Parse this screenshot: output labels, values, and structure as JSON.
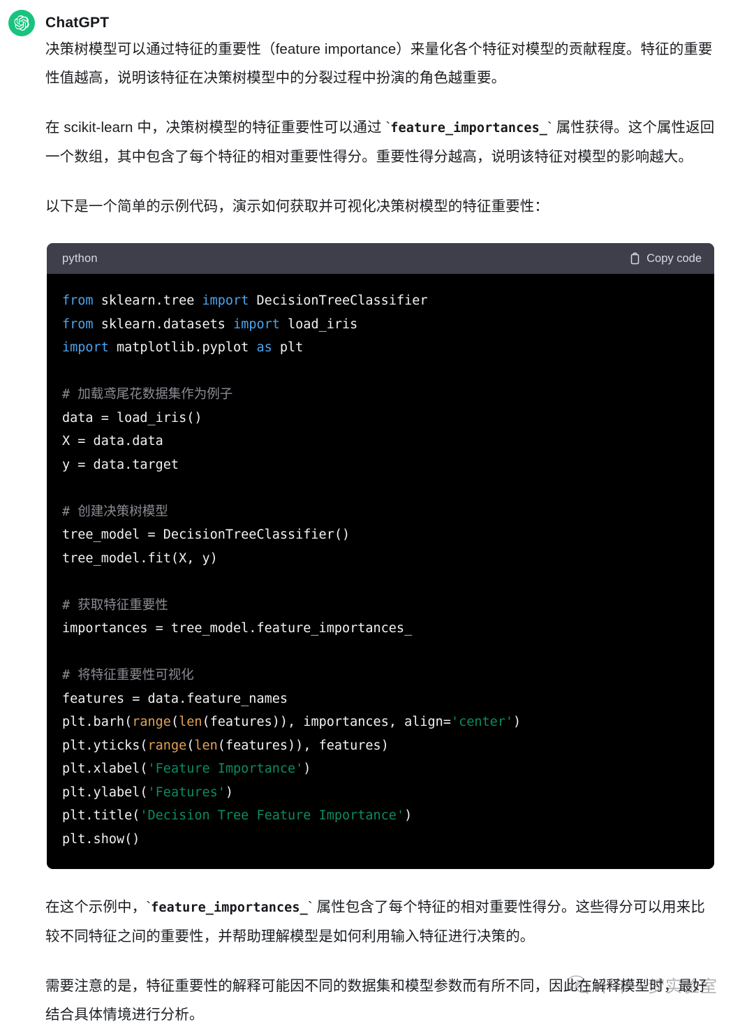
{
  "message": {
    "author": "ChatGPT",
    "avatar_icon": "openai-logo-icon",
    "avatar_color": "#19c37d"
  },
  "paragraphs": {
    "p1": "决策树模型可以通过特征的重要性（feature importance）来量化各个特征对模型的贡献程度。特征的重要性值越高，说明该特征在决策树模型中的分裂过程中扮演的角色越重要。",
    "p2_before": "在 scikit-learn 中，决策树模型的特征重要性可以通过 `",
    "p2_code": "feature_importances_",
    "p2_after": "` 属性获得。这个属性返回一个数组，其中包含了每个特征的相对重要性得分。重要性得分越高，说明该特征对模型的影响越大。",
    "p3": "以下是一个简单的示例代码，演示如何获取并可视化决策树模型的特征重要性：",
    "p4_before": "在这个示例中，`",
    "p4_code": "feature_importances_",
    "p4_after": "` 属性包含了每个特征的相对重要性得分。这些得分可以用来比较不同特征之间的重要性，并帮助理解模型是如何利用输入特征进行决策的。",
    "p5": "需要注意的是，特征重要性的解释可能因不同的数据集和模型参数而有所不同，因此在解释模型时，最好结合具体情境进行分析。"
  },
  "code_block": {
    "language": "python",
    "copy_label": "Copy code",
    "copy_icon": "clipboard-icon",
    "header_bg": "#3e3f4b",
    "body_bg": "#000000",
    "colors": {
      "keyword": "#4aa5f0",
      "builtin": "#e2a254",
      "string": "#0c8a63",
      "comment": "#8b8b93",
      "plain": "#f2f2f2"
    },
    "lines": [
      [
        {
          "t": "from ",
          "c": "kw"
        },
        {
          "t": "sklearn.tree ",
          "c": "pl"
        },
        {
          "t": "import ",
          "c": "kw"
        },
        {
          "t": "DecisionTreeClassifier",
          "c": "pl"
        }
      ],
      [
        {
          "t": "from ",
          "c": "kw"
        },
        {
          "t": "sklearn.datasets ",
          "c": "pl"
        },
        {
          "t": "import ",
          "c": "kw"
        },
        {
          "t": "load_iris",
          "c": "pl"
        }
      ],
      [
        {
          "t": "import ",
          "c": "kw"
        },
        {
          "t": "matplotlib.pyplot ",
          "c": "pl"
        },
        {
          "t": "as ",
          "c": "kw"
        },
        {
          "t": "plt",
          "c": "pl"
        }
      ],
      [],
      [
        {
          "t": "# 加载鸢尾花数据集作为例子",
          "c": "cmt"
        }
      ],
      [
        {
          "t": "data = load_iris()",
          "c": "pl"
        }
      ],
      [
        {
          "t": "X = data.data",
          "c": "pl"
        }
      ],
      [
        {
          "t": "y = data.target",
          "c": "pl"
        }
      ],
      [],
      [
        {
          "t": "# 创建决策树模型",
          "c": "cmt"
        }
      ],
      [
        {
          "t": "tree_model = DecisionTreeClassifier()",
          "c": "pl"
        }
      ],
      [
        {
          "t": "tree_model.fit(X, y)",
          "c": "pl"
        }
      ],
      [],
      [
        {
          "t": "# 获取特征重要性",
          "c": "cmt"
        }
      ],
      [
        {
          "t": "importances = tree_model.feature_importances_",
          "c": "pl"
        }
      ],
      [],
      [
        {
          "t": "# 将特征重要性可视化",
          "c": "cmt"
        }
      ],
      [
        {
          "t": "features = data.feature_names",
          "c": "pl"
        }
      ],
      [
        {
          "t": "plt.barh(",
          "c": "pl"
        },
        {
          "t": "range",
          "c": "bi"
        },
        {
          "t": "(",
          "c": "pl"
        },
        {
          "t": "len",
          "c": "bi"
        },
        {
          "t": "(features)), importances, align=",
          "c": "pl"
        },
        {
          "t": "'center'",
          "c": "str"
        },
        {
          "t": ")",
          "c": "pl"
        }
      ],
      [
        {
          "t": "plt.yticks(",
          "c": "pl"
        },
        {
          "t": "range",
          "c": "bi"
        },
        {
          "t": "(",
          "c": "pl"
        },
        {
          "t": "len",
          "c": "bi"
        },
        {
          "t": "(features)), features)",
          "c": "pl"
        }
      ],
      [
        {
          "t": "plt.xlabel(",
          "c": "pl"
        },
        {
          "t": "'Feature Importance'",
          "c": "str"
        },
        {
          "t": ")",
          "c": "pl"
        }
      ],
      [
        {
          "t": "plt.ylabel(",
          "c": "pl"
        },
        {
          "t": "'Features'",
          "c": "str"
        },
        {
          "t": ")",
          "c": "pl"
        }
      ],
      [
        {
          "t": "plt.title(",
          "c": "pl"
        },
        {
          "t": "'Decision Tree Feature Importance'",
          "c": "str"
        },
        {
          "t": ")",
          "c": "pl"
        }
      ],
      [
        {
          "t": "plt.show()",
          "c": "pl"
        }
      ]
    ]
  },
  "watermark": {
    "text": "十年一梦实验室",
    "icon": "wechat-icon"
  }
}
